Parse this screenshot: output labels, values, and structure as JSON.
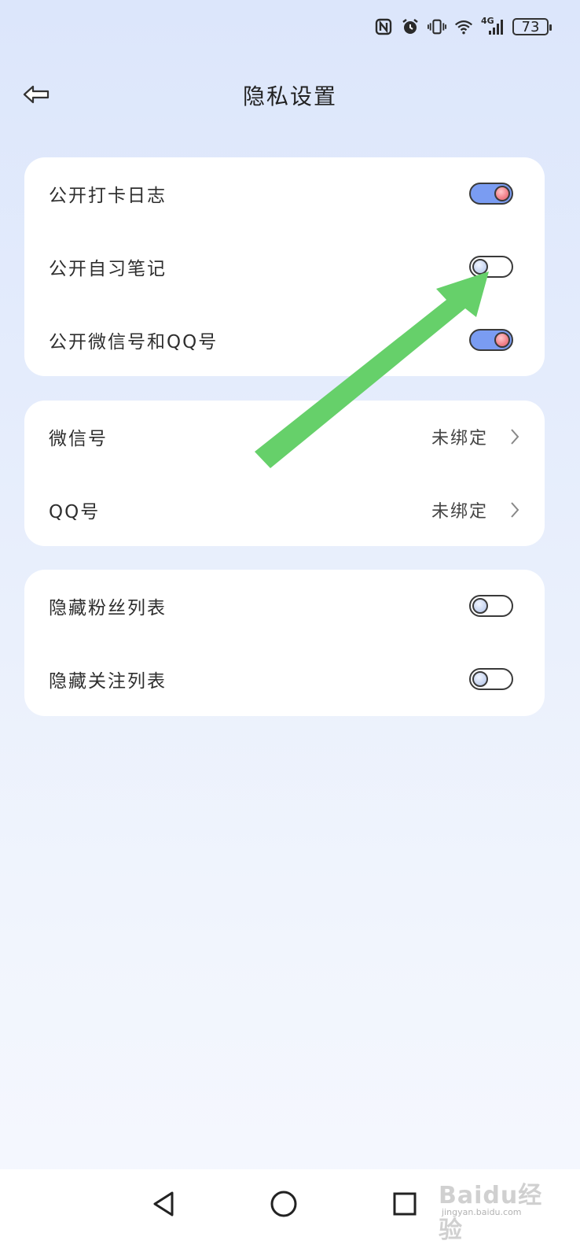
{
  "status_bar": {
    "icons": [
      "nfc-icon",
      "alarm-icon",
      "vibrate-icon",
      "wifi-icon",
      "signal-4g-icon"
    ],
    "network_label": "4G",
    "battery_level": "73"
  },
  "header": {
    "title": "隐私设置",
    "back_icon": "back-arrow-icon"
  },
  "colors": {
    "toggle_on": "#7a9cf2",
    "toggle_knob_on": "#f07f88",
    "toggle_knob_off": "#c9d6f1",
    "annotation_arrow": "#66d06a"
  },
  "sections": {
    "public": {
      "items": [
        {
          "label": "公开打卡日志",
          "toggle": "on"
        },
        {
          "label": "公开自习笔记",
          "toggle": "off"
        },
        {
          "label": "公开微信号和QQ号",
          "toggle": "on"
        }
      ]
    },
    "accounts": {
      "items": [
        {
          "label": "微信号",
          "value": "未绑定"
        },
        {
          "label": "QQ号",
          "value": "未绑定"
        }
      ]
    },
    "hidden": {
      "items": [
        {
          "label": "隐藏粉丝列表",
          "toggle": "off"
        },
        {
          "label": "隐藏关注列表",
          "toggle": "off"
        }
      ]
    }
  },
  "nav_bar": {
    "buttons": [
      "back-triangle-icon",
      "home-circle-icon",
      "recent-square-icon"
    ]
  },
  "watermark": {
    "main": "Baidu经验",
    "sub": "jingyan.baidu.com"
  }
}
